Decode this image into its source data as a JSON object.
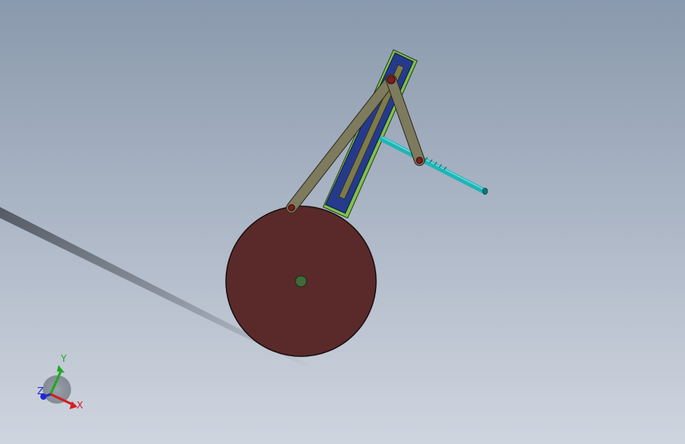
{
  "scene": {
    "background_top": "#8a99ad",
    "background_bottom": "#cfd5df"
  },
  "parts": {
    "crank_disk": {
      "fill": "#5a2a2a",
      "edge": "#1a0e0e"
    },
    "crank_pivot": {
      "fill": "#3f6b3a"
    },
    "slotted_guide": {
      "fill": "#263a8c",
      "edge": "#7fc24a",
      "slot": "#7d7a4a"
    },
    "long_link": {
      "fill": "#7d7a5e",
      "edge": "#2b2a1c"
    },
    "short_link": {
      "fill": "#7d7a5e",
      "edge": "#2b2a1c"
    },
    "output_rod": {
      "fill": "#1fb5b5",
      "edge": "#0d5a5a"
    },
    "pin": {
      "fill": "#7a1e1e",
      "edge": "#2a0909"
    }
  },
  "triad": {
    "x_label": "X",
    "y_label": "Y",
    "z_label": "Z",
    "x_color": "#d21f1f",
    "y_color": "#1faa1f",
    "z_color": "#1f2ad2"
  }
}
